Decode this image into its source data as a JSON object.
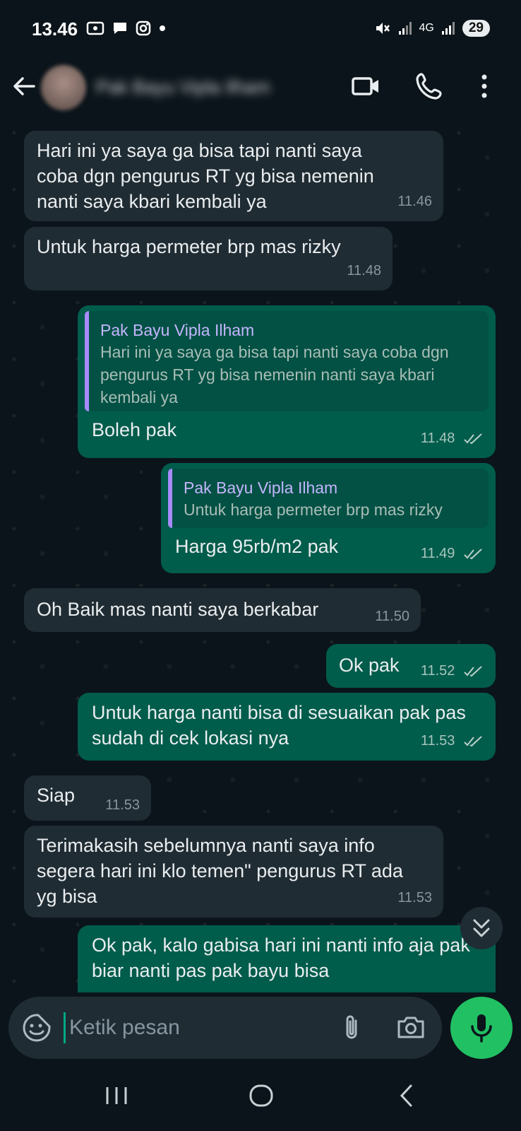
{
  "status_bar": {
    "time": "13.46",
    "network": "4G",
    "battery": "29"
  },
  "header": {
    "contact_name": "Pak Bayu Vipla Ilham"
  },
  "messages": [
    {
      "dir": "in",
      "text": "Hari ini ya saya ga bisa tapi nanti saya coba dgn pengurus RT yg bisa nemenin nanti saya kbari kembali ya",
      "time": "11.46"
    },
    {
      "dir": "in",
      "text": "Untuk harga permeter brp mas rizky",
      "time": "11.48"
    },
    {
      "dir": "out",
      "quote_author": "Pak Bayu Vipla Ilham",
      "quote_text": "Hari ini ya saya ga bisa tapi nanti saya coba dgn pengurus RT yg bisa nemenin nanti saya kbari kembali ya",
      "text": "Boleh pak",
      "time": "11.48"
    },
    {
      "dir": "out",
      "quote_author": "Pak Bayu Vipla Ilham",
      "quote_text": "Untuk harga permeter brp mas rizky",
      "text": "Harga 95rb/m2 pak",
      "time": "11.49"
    },
    {
      "dir": "in",
      "text": "Oh Baik mas nanti saya berkabar",
      "time": "11.50"
    },
    {
      "dir": "out",
      "text": "Ok pak",
      "time": "11.52"
    },
    {
      "dir": "out",
      "text": "Untuk harga nanti bisa di sesuaikan pak pas sudah di cek lokasi nya",
      "time": "11.53"
    },
    {
      "dir": "in",
      "text": "Siap",
      "time": "11.53"
    },
    {
      "dir": "in",
      "text": "Terimakasih sebelumnya nanti saya info segera hari ini klo temen\" pengurus RT ada yg bisa",
      "time": "11.53"
    },
    {
      "dir": "out",
      "text": "Ok pak, kalo gabisa hari ini nanti info aja pak biar nanti pas pak bayu bisa"
    }
  ],
  "composer": {
    "placeholder": "Ketik pesan"
  },
  "colors": {
    "incoming": "#202c33",
    "outgoing": "#005c4b",
    "accent": "#21c063",
    "quote_bar": "#a78bfa"
  }
}
